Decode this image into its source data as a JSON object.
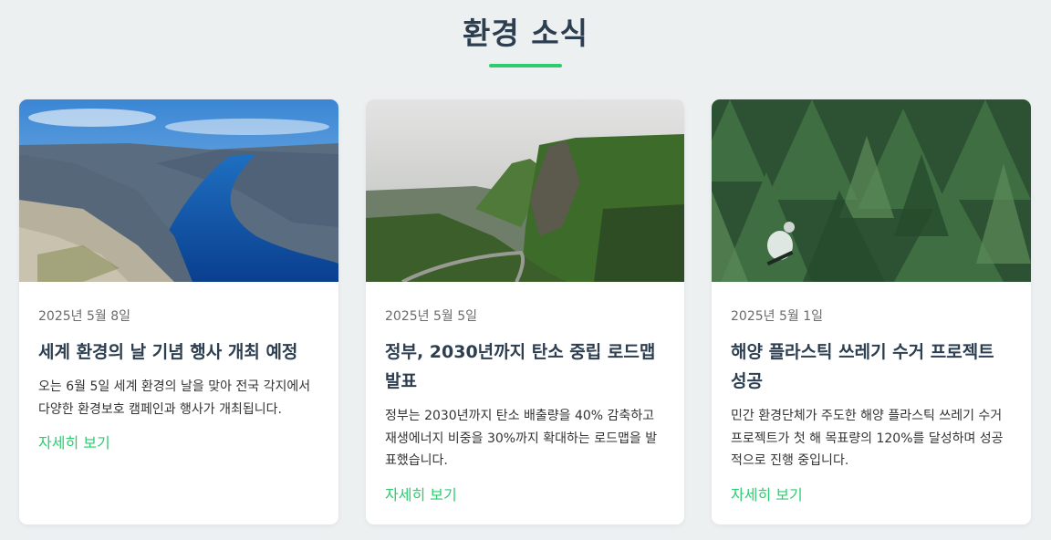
{
  "section": {
    "title": "환경 소식",
    "accent_color": "#2ecc71"
  },
  "cards": [
    {
      "date": "2025년 5월 8일",
      "title": "세계 환경의 날 기념 행사 개최 예정",
      "excerpt": "오는 6월 5일 세계 환경의 날을 맞아 전국 각지에서 다양한 환경보호 캠페인과 행사가 개최됩니다.",
      "link_label": "자세히 보기"
    },
    {
      "date": "2025년 5월 5일",
      "title": "정부, 2030년까지 탄소 중립 로드맵 발표",
      "excerpt": "정부는 2030년까지 탄소 배출량을 40% 감축하고 재생에너지 비중을 30%까지 확대하는 로드맵을 발표했습니다.",
      "link_label": "자세히 보기"
    },
    {
      "date": "2025년 5월 1일",
      "title": "해양 플라스틱 쓰레기 수거 프로젝트 성공",
      "excerpt": "민간 환경단체가 주도한 해양 플라스틱 쓰레기 수거 프로젝트가 첫 해 목표량의 120%를 달성하며 성공적으로 진행 중입니다.",
      "link_label": "자세히 보기"
    }
  ]
}
